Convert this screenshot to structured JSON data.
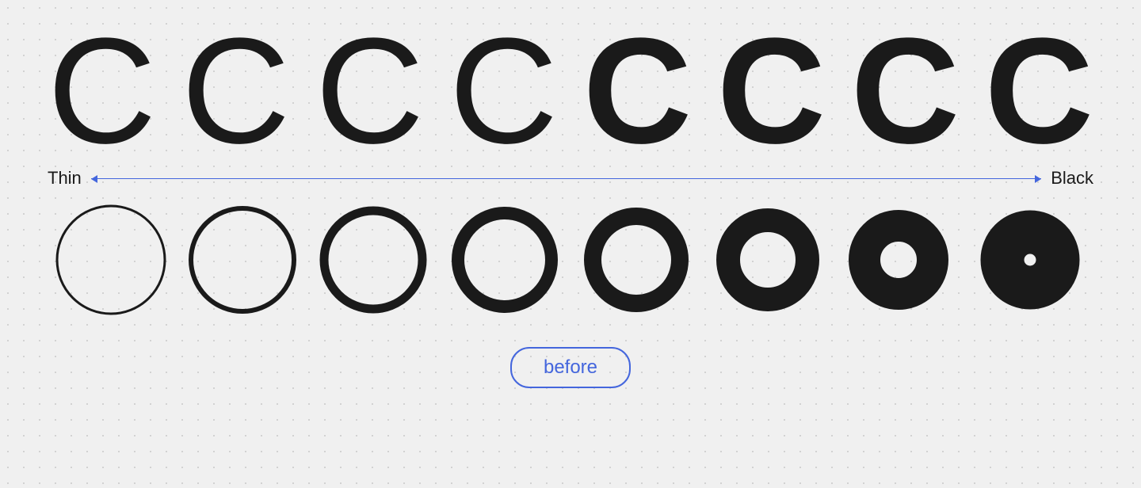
{
  "labels": {
    "thin": "Thin",
    "black": "Black",
    "before": "before"
  },
  "c_glyphs": [
    {
      "weight": 100,
      "letter": "C"
    },
    {
      "weight": 200,
      "letter": "C"
    },
    {
      "weight": 300,
      "letter": "C"
    },
    {
      "weight": 400,
      "letter": "C"
    },
    {
      "weight": 600,
      "letter": "C"
    },
    {
      "weight": 700,
      "letter": "C"
    },
    {
      "weight": 800,
      "letter": "C"
    },
    {
      "weight": 900,
      "letter": "C"
    }
  ],
  "o_circles": [
    {
      "stroke_width": 3,
      "radius": 68
    },
    {
      "stroke_width": 6,
      "radius": 65
    },
    {
      "stroke_width": 11,
      "radius": 62
    },
    {
      "stroke_width": 16,
      "radius": 59
    },
    {
      "stroke_width": 22,
      "radius": 55
    },
    {
      "stroke_width": 30,
      "radius": 50
    },
    {
      "stroke_width": 40,
      "radius": 43
    },
    {
      "stroke_width": 55,
      "radius": 35
    }
  ],
  "colors": {
    "background": "#f0f0f0",
    "glyph": "#1a1a1a",
    "arrow": "#4466dd",
    "label": "#1a1a1a",
    "button_border": "#4466dd",
    "button_text": "#4466dd"
  }
}
